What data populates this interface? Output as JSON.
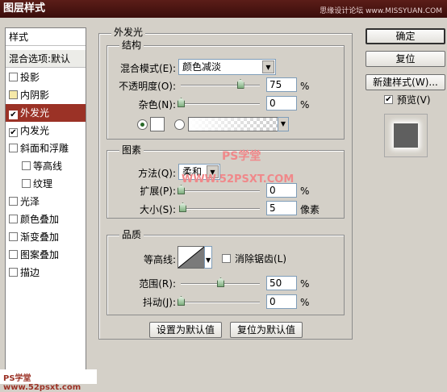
{
  "window": {
    "title": "图层样式",
    "watermark": "思缘设计论坛 www.MISSYUAN.COM"
  },
  "left_panel": {
    "header": "样式",
    "blend_options": "混合选项:默认",
    "items": [
      {
        "label": "投影",
        "checked": false
      },
      {
        "label": "内阴影",
        "checked": false
      },
      {
        "label": "外发光",
        "checked": true,
        "selected": true
      },
      {
        "label": "内发光",
        "checked": true
      },
      {
        "label": "斜面和浮雕",
        "checked": false
      },
      {
        "label": "等高线",
        "checked": false
      },
      {
        "label": "纹理",
        "checked": false
      },
      {
        "label": "光泽",
        "checked": false
      },
      {
        "label": "颜色叠加",
        "checked": false
      },
      {
        "label": "渐变叠加",
        "checked": false
      },
      {
        "label": "图案叠加",
        "checked": false
      },
      {
        "label": "描边",
        "checked": false
      }
    ]
  },
  "outer_glow": {
    "title": "外发光",
    "structure": {
      "title": "结构",
      "blend_mode_label": "混合模式(E):",
      "blend_mode_value": "颜色减淡",
      "opacity_label": "不透明度(O):",
      "opacity_value": "75",
      "noise_label": "杂色(N):",
      "noise_value": "0",
      "percent": "%"
    },
    "elements": {
      "title": "图素",
      "technique_label": "方法(Q):",
      "technique_value": "柔和",
      "spread_label": "扩展(P):",
      "spread_value": "0",
      "size_label": "大小(S):",
      "size_value": "5",
      "size_unit": "像素",
      "percent": "%"
    },
    "quality": {
      "title": "品质",
      "contour_label": "等高线:",
      "antialias_label": "消除锯齿(L)",
      "range_label": "范围(R):",
      "range_value": "50",
      "jitter_label": "抖动(J):",
      "jitter_value": "0",
      "percent": "%"
    },
    "make_default": "设置为默认值",
    "reset_default": "复位为默认值"
  },
  "right_buttons": {
    "ok": "确定",
    "reset": "复位",
    "new_style": "新建样式(W)...",
    "preview_label": "预览(V)",
    "preview_checked": true
  },
  "watermarks": {
    "center_cn": "PS学堂",
    "center_url": "WWW.52PSXT.COM",
    "bottom": "PS学堂 www.52psxt.com"
  },
  "colors": {
    "selected": "#9b3226",
    "titlebar": "#5b1d18",
    "dialog_bg": "#d4d0c8"
  },
  "slider_levels": {
    "opacity": 0.75,
    "noise": 0,
    "spread": 0,
    "size": 0.02,
    "range": 0.5,
    "jitter": 0
  }
}
